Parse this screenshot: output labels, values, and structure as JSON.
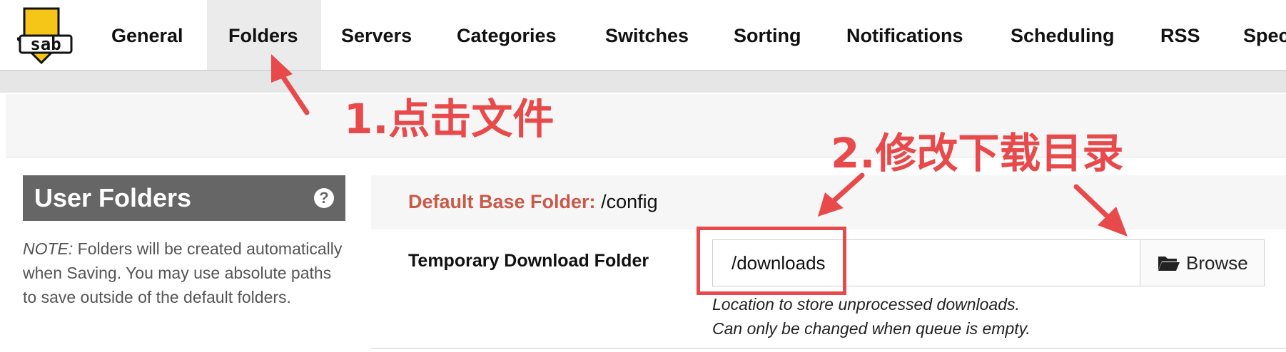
{
  "nav": {
    "logo_text": "sab",
    "items": [
      {
        "label": "General"
      },
      {
        "label": "Folders",
        "active": true
      },
      {
        "label": "Servers"
      },
      {
        "label": "Categories"
      },
      {
        "label": "Switches"
      },
      {
        "label": "Sorting"
      },
      {
        "label": "Notifications"
      },
      {
        "label": "Scheduling"
      },
      {
        "label": "RSS"
      },
      {
        "label": "Spec"
      }
    ]
  },
  "sidebar": {
    "title": "User Folders",
    "help_icon": "question-circle-icon",
    "note_prefix": "NOTE:",
    "note_text": " Folders will be created automatically when Saving. You may use absolute paths to save outside of the default folders."
  },
  "folders": {
    "base_label": "Default Base Folder:",
    "base_value": " /config",
    "temp_label": "Temporary Download Folder",
    "temp_value": "/downloads",
    "browse_label": "Browse",
    "browse_icon": "folder-open-icon",
    "help_line1": "Location to store unprocessed downloads.",
    "help_line2": "Can only be changed when queue is empty."
  },
  "annotations": {
    "step1": "1.点击文件",
    "step2": "2.修改下载目录",
    "color": "#e8494a"
  },
  "colors": {
    "header_bg": "#666666",
    "label_red": "#c95a4a",
    "active_tab_bg": "#ebebeb",
    "logo_yellow": "#f5c518"
  }
}
